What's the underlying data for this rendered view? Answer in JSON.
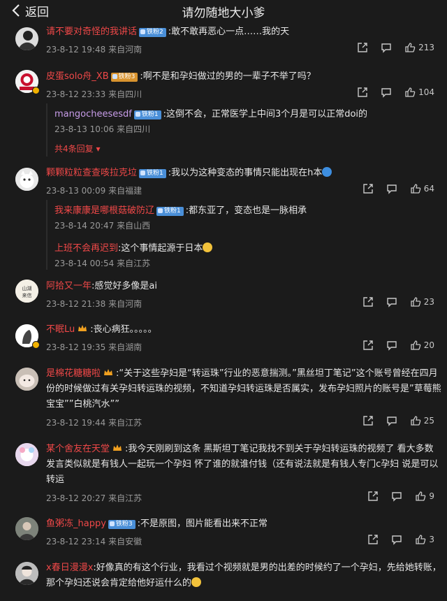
{
  "header": {
    "back_label": "返回",
    "title": "请勿随地大小爹"
  },
  "comments": [
    {
      "name": "请不要对奇怪的我讲话",
      "badge": "铁粉2",
      "text": ":敢不敢再恶心一点……我的天",
      "time": "23-8-12 19:48",
      "loc": "来自河南",
      "likes": "213"
    },
    {
      "name": "皮蛋solo舟_XB",
      "badge": "铁粉3",
      "text": ":啊不是和孕妇做过的男的一辈子不举了吗？",
      "time": "23-8-12 23:33",
      "loc": "来自四川",
      "likes": "104",
      "replies": [
        {
          "name": "mangocheesesdf",
          "badge": "铁粉1",
          "text": ":这倒不会，正常医学上中间3个月是可以正常doi的",
          "time": "23-8-13 10:06",
          "loc": "来自四川"
        }
      ],
      "more": "共4条回复"
    },
    {
      "name": "颗颗粒粒查查咳拉克垃",
      "badge": "铁粉1",
      "text": ":我以为这种变态的事情只能出现在h本",
      "time": "23-8-13 00:09",
      "loc": "来自福建",
      "likes": "64",
      "replies": [
        {
          "name": "我来康康是哪根菇破防辽",
          "badge": "铁粉1",
          "text": ":都东亚了，变态也是一脉相承",
          "time": "23-8-14 20:47",
          "loc": "来自山西"
        },
        {
          "name": "上班不会再迟到",
          "text": ":这个事情起源于日本",
          "time": "23-8-14 00:54",
          "loc": "来自江苏"
        }
      ]
    },
    {
      "name": "阿拾又一年",
      "text": ":感觉好多像是ai",
      "time": "23-8-12 21:38",
      "loc": "来自河南",
      "likes": "23"
    },
    {
      "name": "不眠Lu",
      "text": ":丧心病狂。。。。。",
      "time": "23-8-12 19:35",
      "loc": "来自湖南",
      "likes": "20"
    },
    {
      "name": "是棉花糖糖啦",
      "text": ":“关于这些孕妇是“转运珠”行业的恶意揣测。”黑丝坦丁笔记”这个账号曾经在四月份的时候做过有关孕妇转运珠的视频，不知道孕妇转运珠是否属实，发布孕妇照片的账号是”草莓熊宝宝””白桃汽水””",
      "time": "23-8-12 19:44",
      "loc": "来自江苏",
      "likes": "25"
    },
    {
      "name": "某个舍友在天堂",
      "text": ":我今天刚刷到这条 黑斯坦丁笔记我找不到关于孕妇转运珠的视频了 看大多数发言类似就是有钱人一起玩一个孕妇 怀了谁的就谁付钱（还有说法就是有钱人专门c孕妇 说是可以转运",
      "time": "23-8-12 20:27",
      "loc": "来自江苏",
      "likes": "9"
    },
    {
      "name": "鱼粥冻_happy",
      "badge": "铁粉3",
      "text": ":不是原图，图片能看出来不正常",
      "time": "23-8-12 23:14",
      "loc": "来自安徽",
      "likes": "3"
    },
    {
      "name": "x春日漫漫x",
      "text": ":好像真的有这个行业，我看过个视频就是男的出差的时候约了一个孕妇，先给她转账，那个孕妇还说会肯定给他好运什么的"
    }
  ],
  "colors": {
    "accent": "#f04848",
    "bg": "#1b1b1b",
    "meta": "#9a9a9a"
  },
  "icons": [
    "back-chevron-icon",
    "share-icon",
    "comment-icon",
    "like-icon"
  ]
}
